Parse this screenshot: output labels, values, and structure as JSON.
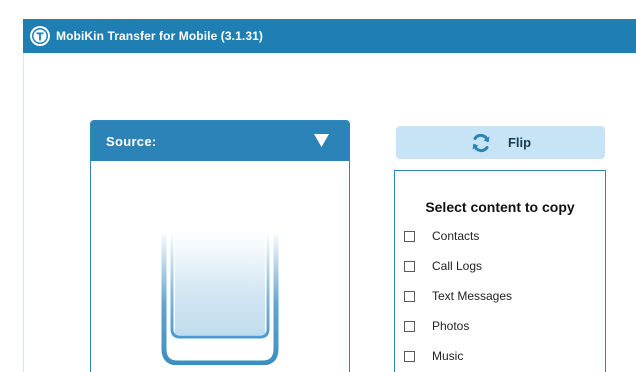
{
  "app": {
    "title": "MobiKin Transfer for Mobile (3.1.31)"
  },
  "source": {
    "label": "Source:"
  },
  "flip": {
    "label": "Flip"
  },
  "content": {
    "title": "Select content to copy",
    "items": [
      {
        "label": "Contacts",
        "checked": false
      },
      {
        "label": "Call Logs",
        "checked": false
      },
      {
        "label": "Text Messages",
        "checked": false
      },
      {
        "label": "Photos",
        "checked": false
      },
      {
        "label": "Music",
        "checked": false
      }
    ]
  },
  "colors": {
    "titlebar": "#1f7fb3",
    "panel_header": "#2c83b7",
    "flip_bg": "#c7e4f6",
    "border": "#2e86b9"
  },
  "icons": {
    "logo": "mobikin-logo-icon",
    "dropdown": "triangle-down-icon",
    "flip": "refresh-arrows-icon",
    "device": "phone-icon"
  }
}
